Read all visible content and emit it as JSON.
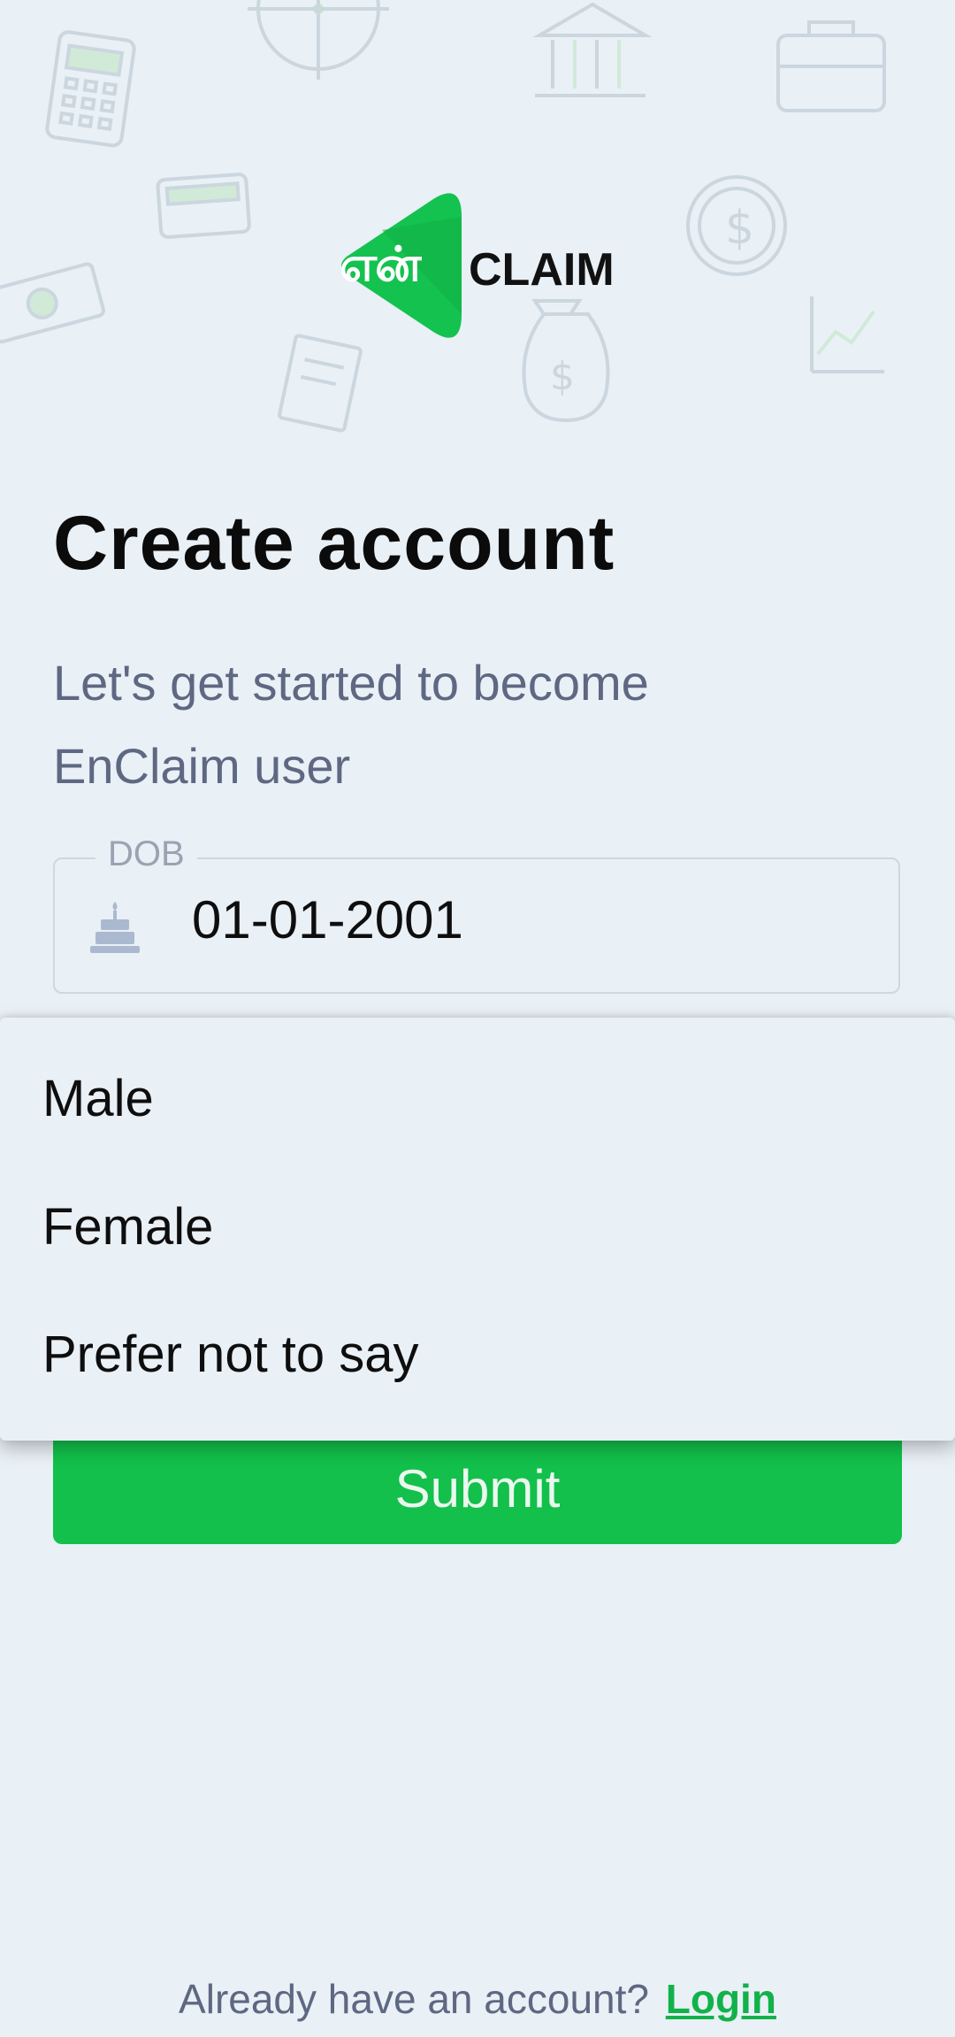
{
  "brand": {
    "logo_tamil_text": "என்",
    "logo_text": "CLAIM",
    "accent_color": "#12c04b"
  },
  "header": {
    "title": "Create account",
    "subtitle": "Let's get started to become EnClaim user"
  },
  "form": {
    "dob": {
      "label": "DOB",
      "value": "01-01-2001",
      "icon": "cake-icon"
    },
    "gender_dropdown": {
      "options": [
        "Male",
        "Female",
        "Prefer not to say"
      ]
    },
    "submit_label": "Submit"
  },
  "footer": {
    "prompt": "Already have an account?",
    "login_label": "Login"
  }
}
